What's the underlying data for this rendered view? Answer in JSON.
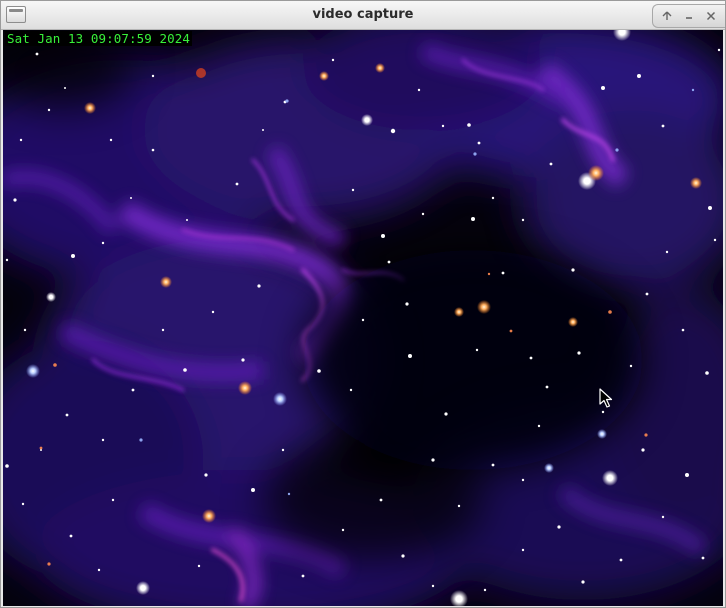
{
  "window": {
    "title": "video capture",
    "controls": [
      "maximize",
      "minimize",
      "close"
    ]
  },
  "overlay": {
    "timestamp": "Sat Jan 13 09:07:59 2024",
    "timestamp_color": "#38f03a"
  },
  "scene": {
    "description": "starfield-nebula",
    "background_color": "#05030d",
    "nebula_color": "#5a1fb0"
  },
  "icons": {
    "window_menu": "window-menu-icon",
    "maximize": "maximize-icon",
    "minimize": "minimize-icon",
    "close": "close-icon",
    "cursor": "mouse-cursor-icon"
  }
}
